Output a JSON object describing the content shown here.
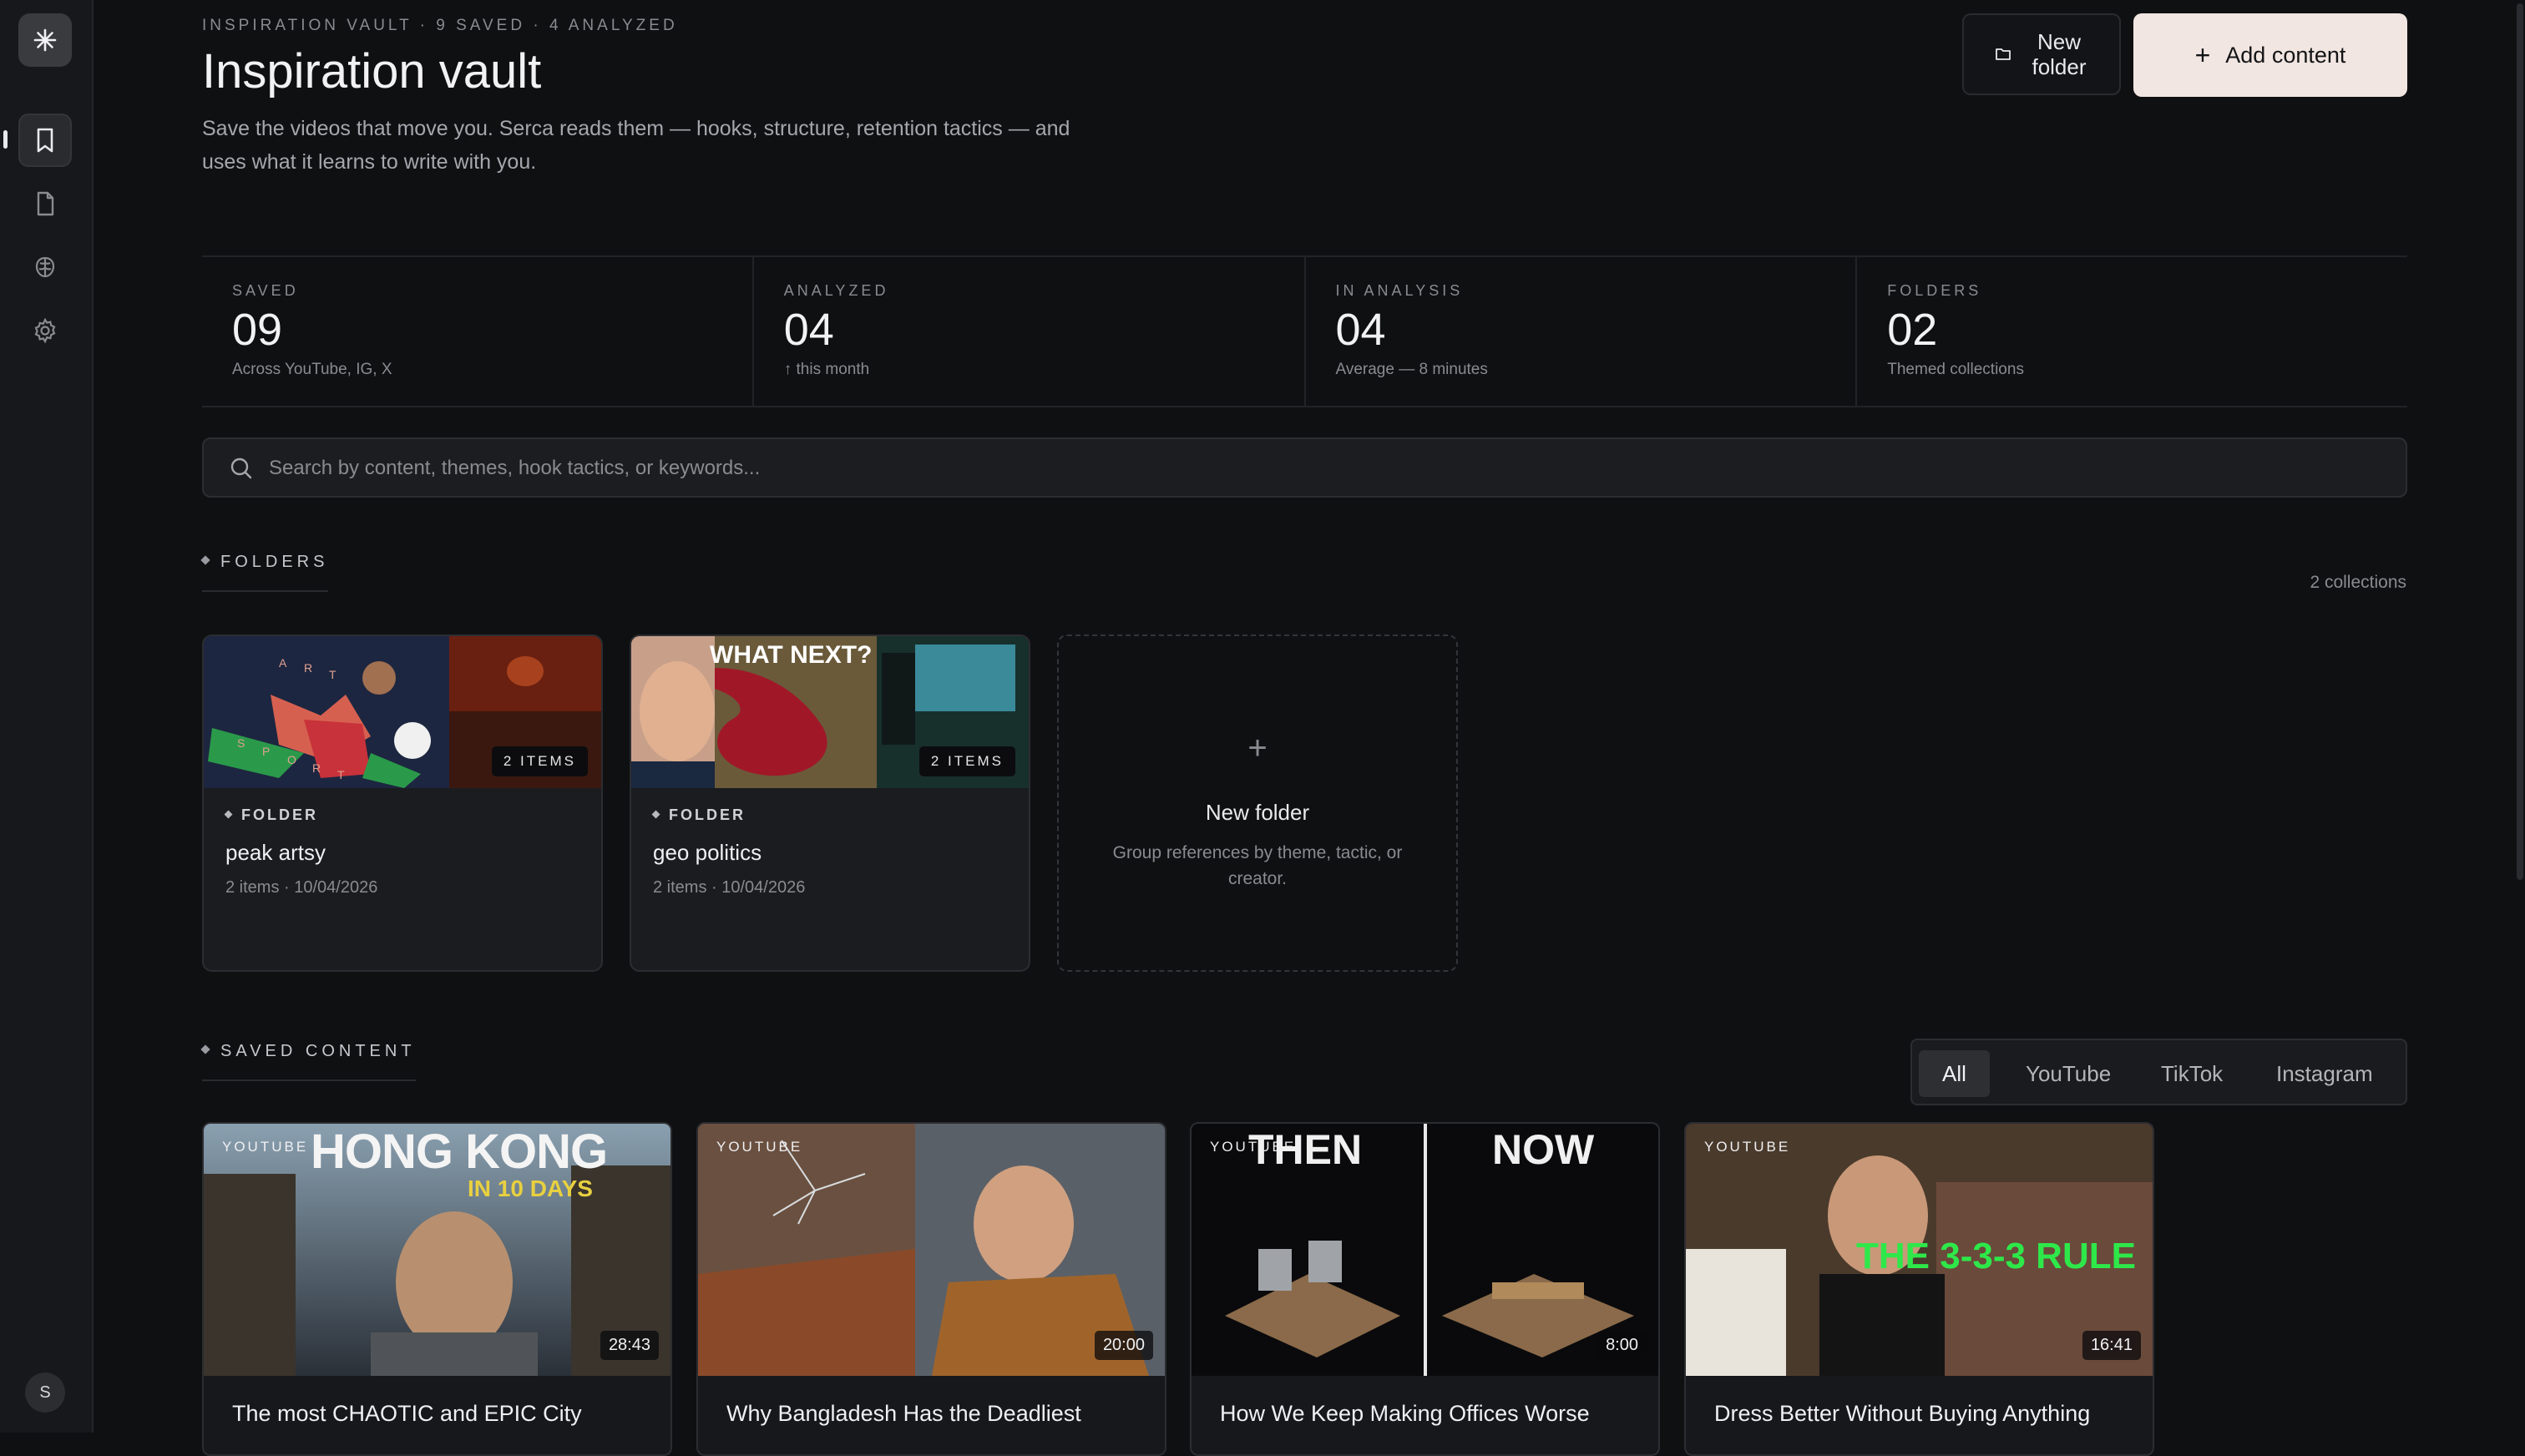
{
  "header": {
    "eyebrow": "INSPIRATION VAULT · 9 SAVED · 4 ANALYZED",
    "title": "Inspiration vault",
    "subtitle": "Save the videos that move you. Serca reads them — hooks, structure, retention tactics — and uses what it learns to write with you.",
    "new_folder_label": "New folder",
    "add_content_label": "Add content"
  },
  "sidebar": {
    "logo_icon": "asterisk-icon",
    "items": [
      {
        "name": "inspiration",
        "icon": "bookmark-icon",
        "active": true
      },
      {
        "name": "scripts",
        "icon": "document-icon",
        "active": false
      },
      {
        "name": "brain",
        "icon": "brain-icon",
        "active": false
      },
      {
        "name": "settings",
        "icon": "gear-icon",
        "active": false
      }
    ],
    "avatar_initial": "S"
  },
  "stats": [
    {
      "label": "SAVED",
      "value": "09",
      "sub": "Across YouTube, IG, X"
    },
    {
      "label": "ANALYZED",
      "value": "04",
      "sub": "↑ this month"
    },
    {
      "label": "IN ANALYSIS",
      "value": "04",
      "sub": "Average — 8 minutes"
    },
    {
      "label": "FOLDERS",
      "value": "02",
      "sub": "Themed collections"
    }
  ],
  "search": {
    "placeholder": "Search by content, themes, hook tactics, or keywords..."
  },
  "folders_section": {
    "label": "FOLDERS",
    "count_label": "2 collections",
    "folders": [
      {
        "tag": "FOLDER",
        "name": "peak artsy",
        "meta": "2 items · 10/04/2026",
        "badge": "2 ITEMS",
        "thumb_words": [
          "A",
          "R",
          "T",
          "S",
          "P",
          "O",
          "R",
          "T"
        ]
      },
      {
        "tag": "FOLDER",
        "name": "geo politics",
        "meta": "2 items · 10/04/2026",
        "badge": "2 ITEMS",
        "thumb_text": "WHAT NEXT?"
      }
    ],
    "new_folder": {
      "title": "New folder",
      "desc": "Group references by theme, tactic, or creator."
    }
  },
  "saved_section": {
    "label": "SAVED CONTENT",
    "filters": [
      "All",
      "YouTube",
      "TikTok",
      "Instagram"
    ],
    "active_filter": "All",
    "videos": [
      {
        "platform": "YOUTUBE",
        "duration": "28:43",
        "title": "The most CHAOTIC and EPIC City",
        "thumb_text": "HONG KONG",
        "thumb_text2": "IN 10 DAYS"
      },
      {
        "platform": "YOUTUBE",
        "duration": "20:00",
        "title": "Why Bangladesh Has the Deadliest"
      },
      {
        "platform": "YOUTUBE",
        "duration": "8:00",
        "title": "How We Keep Making Offices Worse",
        "thumb_text": "THEN",
        "thumb_text2": "NOW"
      },
      {
        "platform": "YOUTUBE",
        "duration": "16:41",
        "title": "Dress Better Without Buying Anything",
        "thumb_text": "THE 3-3-3 RULE"
      }
    ]
  }
}
